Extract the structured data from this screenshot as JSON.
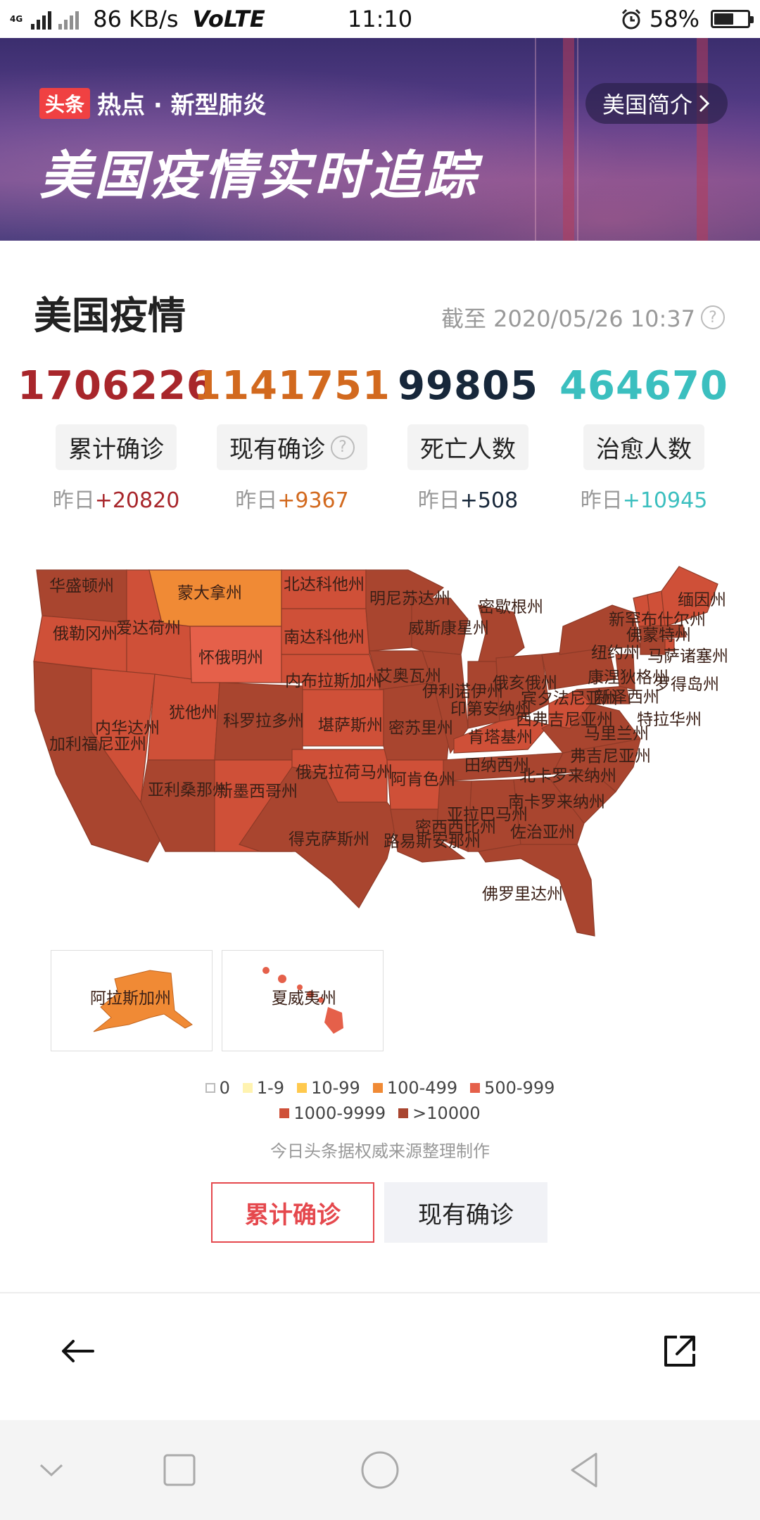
{
  "status_bar": {
    "network": "4G",
    "speed": "86 KB/s",
    "volte": "VoLTE",
    "time": "11:10",
    "battery": "58%",
    "battery_level": 0.58
  },
  "banner": {
    "tag": "头条",
    "tag_text": "热点 · 新型肺炎",
    "title": "美国疫情实时追踪",
    "intro_button": "美国简介"
  },
  "summary": {
    "title": "美国疫情",
    "updated": "截至 2020/05/26 10:37",
    "stats": [
      {
        "value": "1706226",
        "label": "累计确诊",
        "delta_prefix": "昨日",
        "delta": "+20820",
        "color": "#a8262b",
        "delta_color": "#a8262b",
        "help": false
      },
      {
        "value": "1141751",
        "label": "现有确诊",
        "delta_prefix": "昨日",
        "delta": "+9367",
        "color": "#d2691e",
        "delta_color": "#d2691e",
        "help": true
      },
      {
        "value": "99805",
        "label": "死亡人数",
        "delta_prefix": "昨日",
        "delta": "+508",
        "color": "#17273a",
        "delta_color": "#17273a",
        "help": false
      },
      {
        "value": "464670",
        "label": "治愈人数",
        "delta_prefix": "昨日",
        "delta": "+10945",
        "color": "#3bbfbf",
        "delta_color": "#3bbfbf",
        "help": false
      }
    ]
  },
  "map": {
    "labels": {
      "washington": "华盛顿州",
      "montana": "蒙大拿州",
      "north_dakota": "北达科他州",
      "minnesota": "明尼苏达州",
      "michigan": "密歇根州",
      "maine": "缅因州",
      "new_hampshire": "新罕布什尔州",
      "oregon": "俄勒冈州",
      "idaho": "爱达荷州",
      "south_dakota": "南达科他州",
      "wisconsin": "威斯康星州",
      "vermont": "佛蒙特州",
      "new_york": "纽约州",
      "massachusetts": "马萨诸塞州",
      "wyoming": "怀俄明州",
      "nebraska": "内布拉斯加州",
      "iowa": "艾奥瓦州",
      "illinois": "伊利诺伊州",
      "indiana": "印第安纳州",
      "ohio": "俄亥俄州",
      "pennsylvania": "宾夕法尼亚州",
      "connecticut": "康涅狄格州",
      "rhode_island": "罗得岛州",
      "new_jersey": "新泽西州",
      "nevada": "内华达州",
      "utah": "犹他州",
      "colorado": "科罗拉多州",
      "kansas": "堪萨斯州",
      "missouri": "密苏里州",
      "kentucky": "肯塔基州",
      "west_virginia": "西弗吉尼亚州",
      "maryland": "马里兰州",
      "delaware": "特拉华州",
      "california": "加利福尼亚州",
      "virginia": "弗吉尼亚州",
      "tennessee": "田纳西州",
      "north_carolina": "北卡罗来纳州",
      "arizona": "亚利桑那州",
      "new_mexico": "新墨西哥州",
      "oklahoma": "俄克拉荷马州",
      "arkansas": "阿肯色州",
      "south_carolina": "南卡罗来纳州",
      "alabama": "亚拉巴马州",
      "mississippi": "密西西比州",
      "georgia": "佐治亚州",
      "texas": "得克萨斯州",
      "louisiana": "路易斯安那州",
      "florida": "佛罗里达州",
      "alaska": "阿拉斯加州",
      "hawaii": "夏威夷州"
    },
    "colors": {
      "c0": "#ffffff",
      "c1": "#fff3b0",
      "c2": "#ffc94d",
      "c3": "#f08a35",
      "c4": "#e5604a",
      "c5": "#cf5038",
      "c6": "#a9452f"
    }
  },
  "legend": {
    "items": [
      {
        "label": "0",
        "color": "#ffffff"
      },
      {
        "label": "1-9",
        "color": "#fff3b0"
      },
      {
        "label": "10-99",
        "color": "#ffc94d"
      },
      {
        "label": "100-499",
        "color": "#f08a35"
      },
      {
        "label": "500-999",
        "color": "#e5604a"
      },
      {
        "label": "1000-9999",
        "color": "#cf5038"
      },
      {
        "label": ">10000",
        "color": "#a9452f"
      }
    ],
    "source": "今日头条据权威来源整理制作"
  },
  "toggle": {
    "active": "累计确诊",
    "inactive": "现有确诊"
  },
  "icons": {
    "back": "back-arrow-icon",
    "share": "share-icon"
  }
}
